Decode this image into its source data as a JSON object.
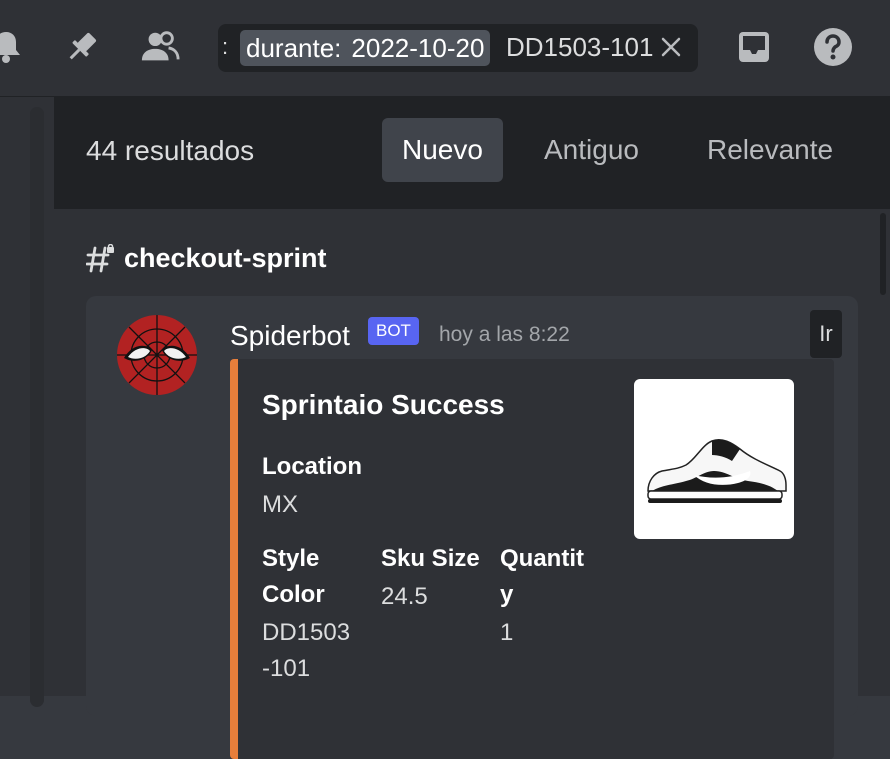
{
  "toolbar": {
    "icons": [
      "bell-icon",
      "pin-icon",
      "members-icon",
      "inbox-icon",
      "help-icon"
    ]
  },
  "search": {
    "prefix": ":",
    "filter_label": "durante:",
    "filter_value": "2022-10-20",
    "term": "DD1503-101"
  },
  "results": {
    "count_label": "44 resultados",
    "tabs": [
      "Nuevo",
      "Antiguo",
      "Relevante"
    ],
    "active_tab": "Nuevo"
  },
  "channel": {
    "name": "checkout-sprint"
  },
  "message": {
    "author": "Spiderbot",
    "badge": "BOT",
    "timestamp": "hoy a las 8:22",
    "jump_label": "Ir",
    "accent_color": "#e67e3b",
    "embed": {
      "title": "Sprintaio Success",
      "fields": {
        "location": {
          "name": "Location",
          "value": "MX"
        },
        "style": {
          "name_l1": "Style",
          "name_l2": "Color",
          "value_l1": "DD1503",
          "value_l2": "-101"
        },
        "size": {
          "name": "Sku Size",
          "value": "24.5"
        },
        "qty": {
          "name_l1": "Quantit",
          "name_l2": "y",
          "value": "1"
        }
      }
    }
  },
  "colors": {
    "bot_badge": "#5865f2",
    "background": "#36393f"
  }
}
